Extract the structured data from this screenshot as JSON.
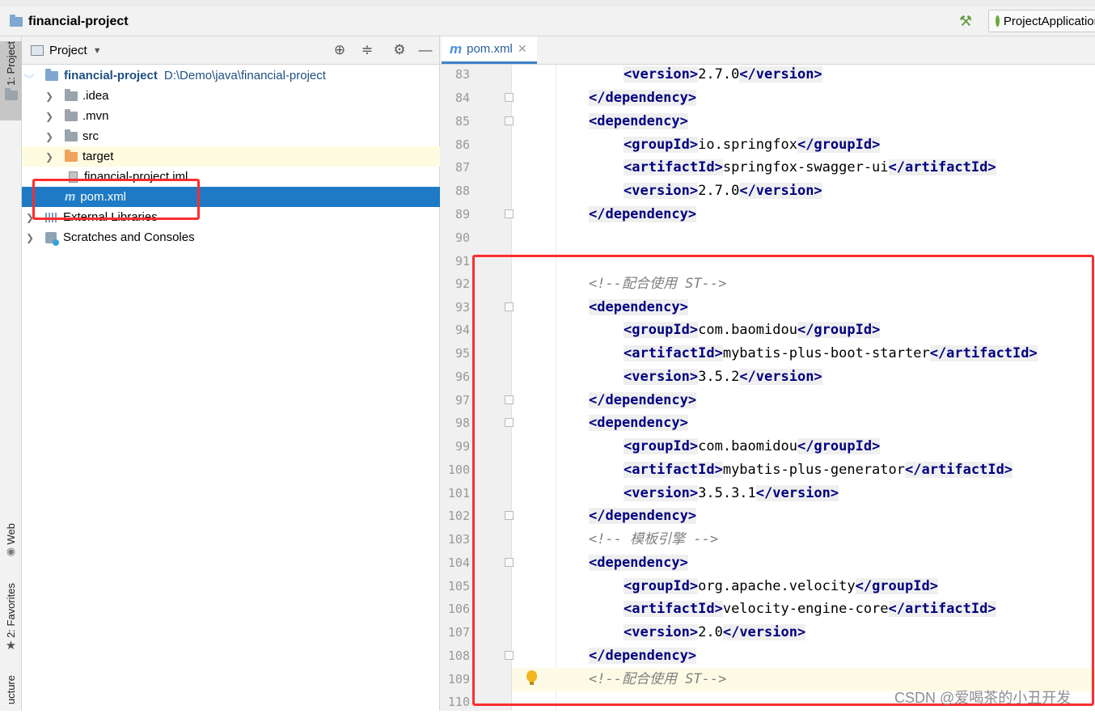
{
  "window": {
    "project_title": "financial-project",
    "run_config": "ProjectApplication"
  },
  "tool_strip": {
    "project_tab": "1: Project",
    "web_tab": "Web",
    "favorites_tab": "2: Favorites",
    "structure_tab": "ucture"
  },
  "project_panel": {
    "title": "Project",
    "tree": [
      {
        "label": "financial-project",
        "path": "D:\\Demo\\java\\financial-project",
        "type": "root"
      },
      {
        "label": ".idea",
        "type": "folder"
      },
      {
        "label": ".mvn",
        "type": "folder"
      },
      {
        "label": "src",
        "type": "folder"
      },
      {
        "label": "target",
        "type": "folder-excluded"
      },
      {
        "label": "financial-project.iml",
        "type": "file"
      },
      {
        "label": "pom.xml",
        "type": "maven-file"
      },
      {
        "label": "External Libraries",
        "type": "libraries"
      },
      {
        "label": "Scratches and Consoles",
        "type": "scratches"
      }
    ]
  },
  "editor": {
    "tab_label": "pom.xml",
    "line_numbers": [
      "83",
      "84",
      "85",
      "86",
      "87",
      "88",
      "89",
      "90",
      "91",
      "92",
      "93",
      "94",
      "95",
      "96",
      "97",
      "98",
      "99",
      "100",
      "101",
      "102",
      "103",
      "104",
      "105",
      "106",
      "107",
      "108",
      "109",
      "110"
    ],
    "code": {
      "c83": "2.7.0",
      "c86": "io.springfox",
      "c87": "springfox-swagger-ui",
      "c88": "2.7.0",
      "c92": "<!--配合使用 ST-->",
      "c94": "com.baomidou",
      "c95": "mybatis-plus-boot-starter",
      "c96": "3.5.2",
      "c99": "com.baomidou",
      "c100": "mybatis-plus-generator",
      "c101": "3.5.3.1",
      "c103": "<!-- 模板引擎 -->",
      "c105": "org.apache.velocity",
      "c106": "velocity-engine-core",
      "c107": "2.0",
      "c109": "<!--配合使用 ST-->"
    },
    "tags": {
      "version_open": "<version>",
      "version_close": "</version>",
      "dependency_open": "<dependency>",
      "dependency_close": "</dependency>",
      "groupId_open": "<groupId>",
      "groupId_close": "</groupId>",
      "artifactId_open": "<artifactId>",
      "artifactId_close": "</artifactId>"
    }
  },
  "watermark": "CSDN @爱喝茶的小丑开发",
  "colors": {
    "selection": "#1e7ac4",
    "tag": "#000080",
    "annotation_red": "#ff2d2d"
  }
}
